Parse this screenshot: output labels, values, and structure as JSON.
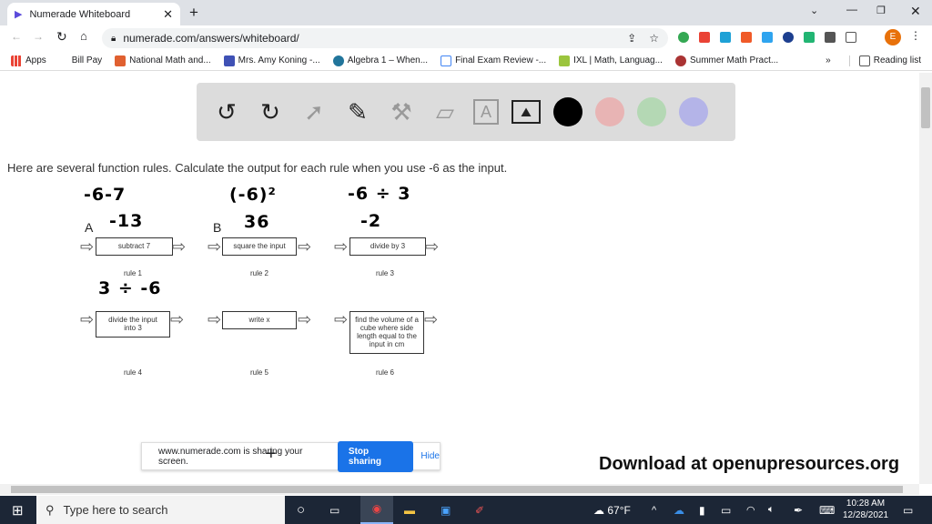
{
  "browser": {
    "tab_title": "Numerade Whiteboard",
    "url": "numerade.com/answers/whiteboard/",
    "profile_initial": "E",
    "bookmarks": [
      "Apps",
      "Bill Pay",
      "National Math and...",
      "Mrs. Amy Koning -...",
      "Algebra 1 – When...",
      "Final Exam Review -...",
      "IXL | Math, Languag...",
      "Summer Math Pract..."
    ],
    "reading_list": "Reading list",
    "more": "»"
  },
  "whiteboard": {
    "colors": [
      "#000000",
      "#e8b4b4",
      "#b4d8b4",
      "#b4b4e8"
    ]
  },
  "problem": {
    "prompt": "Here are several function rules. Calculate the output for each rule when you use -6 as the input.",
    "rules": [
      {
        "text": "subtract 7",
        "label": "rule 1"
      },
      {
        "text": "square the input",
        "label": "rule 2"
      },
      {
        "text": "divide by 3",
        "label": "rule 3"
      },
      {
        "text": "divide the input into 3",
        "label": "rule 4"
      },
      {
        "text": "write x",
        "label": "rule 5"
      },
      {
        "text": "find the volume of a cube where side length equal to the input in cm",
        "label": "rule 6"
      }
    ],
    "letters": [
      "A",
      "B"
    ],
    "handwriting": {
      "r1_expr": "-6-7",
      "r1_ans": "-13",
      "r2_expr": "(-6)²",
      "r2_ans": "36",
      "r3_expr": "-6 ÷ 3",
      "r3_ans": "-2",
      "r4_expr": "3 ÷ -6"
    },
    "credit": "Download at openupresources.org"
  },
  "share": {
    "message": "www.numerade.com is sharing your screen.",
    "stop": "Stop sharing",
    "hide": "Hide"
  },
  "taskbar": {
    "search_placeholder": "Type here to search",
    "weather": "67°F",
    "time": "10:28 AM",
    "date": "12/28/2021"
  }
}
